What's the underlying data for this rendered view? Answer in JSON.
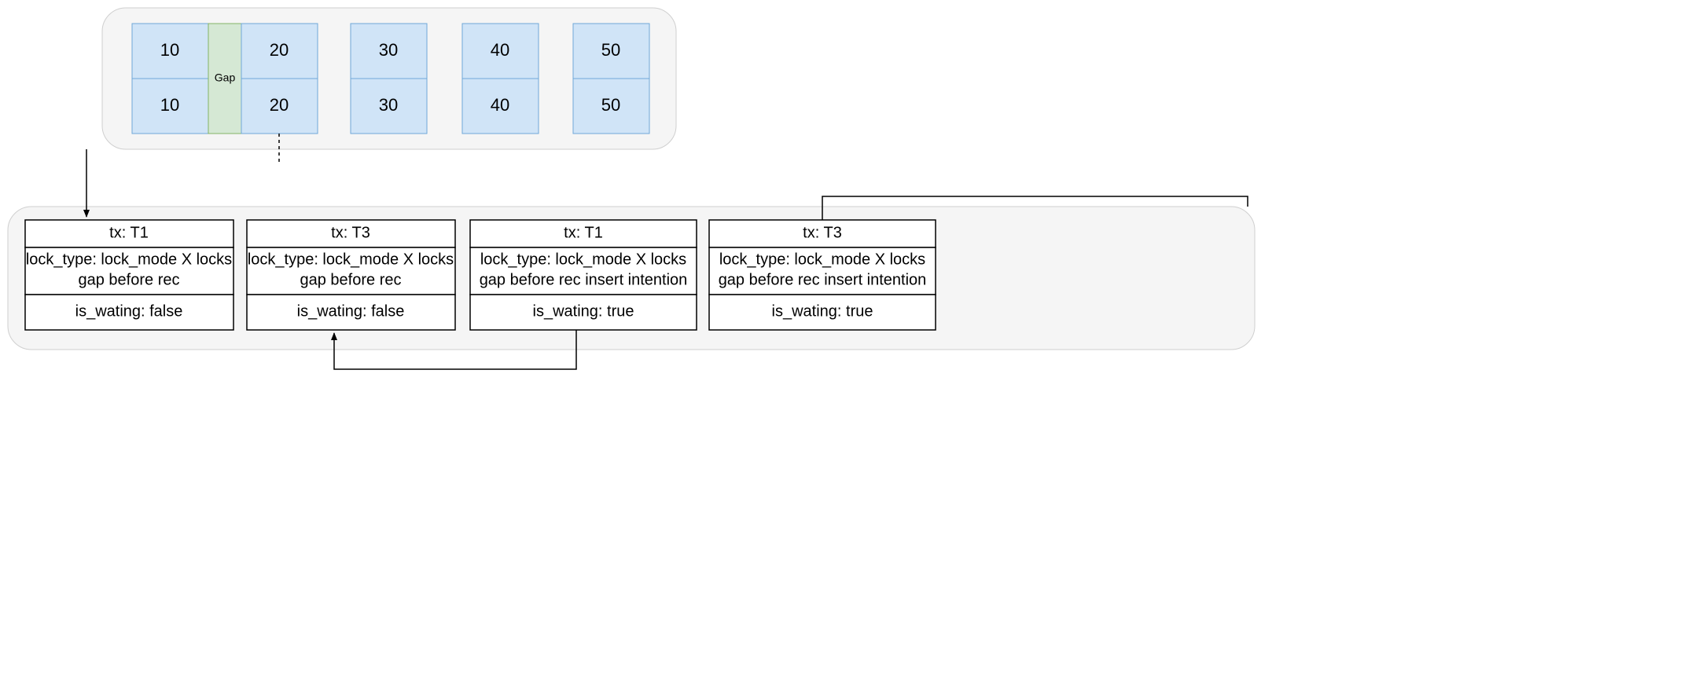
{
  "index": {
    "columns": [
      {
        "top": "10",
        "bottom": "10"
      },
      {
        "top": "20",
        "bottom": "20"
      },
      {
        "top": "30",
        "bottom": "30"
      },
      {
        "top": "40",
        "bottom": "40"
      },
      {
        "top": "50",
        "bottom": "50"
      }
    ],
    "gap_label": "Gap"
  },
  "locks": [
    {
      "tx": "tx: T1",
      "lock_type_line1": "lock_type: lock_mode X locks",
      "lock_type_line2": "gap before rec",
      "is_waiting": "is_wating: false"
    },
    {
      "tx": "tx: T3",
      "lock_type_line1": "lock_type: lock_mode X locks",
      "lock_type_line2": "gap before rec",
      "is_waiting": "is_wating: false"
    },
    {
      "tx": "tx: T1",
      "lock_type_line1": "lock_type: lock_mode X locks",
      "lock_type_line2": "gap before rec insert intention",
      "is_waiting": "is_wating: true"
    },
    {
      "tx": "tx: T3",
      "lock_type_line1": "lock_type: lock_mode X locks",
      "lock_type_line2": "gap before rec insert intention",
      "is_waiting": "is_wating: true"
    }
  ]
}
